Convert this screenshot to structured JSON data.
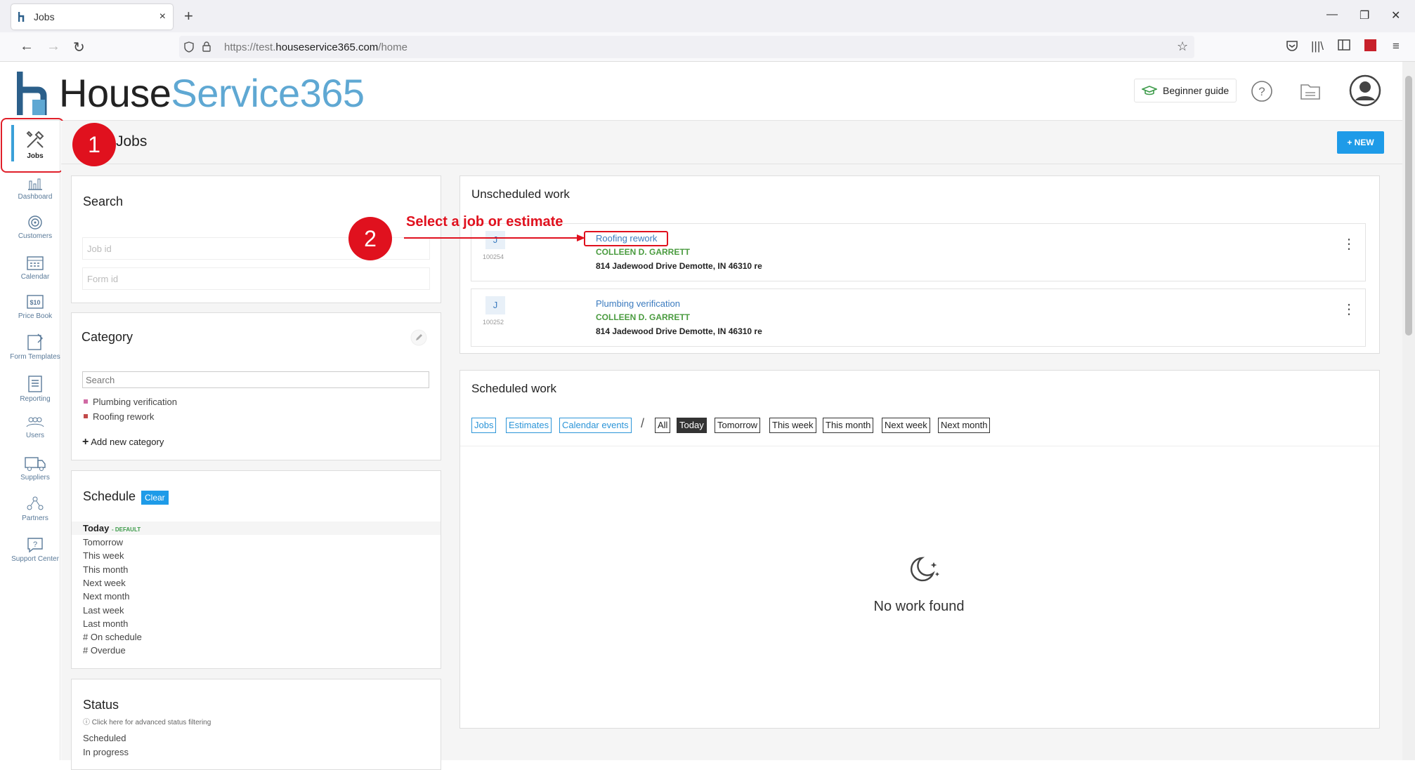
{
  "browser": {
    "tab_title": "Jobs",
    "tab_close": "×",
    "new_tab": "+",
    "url_prefix": "https://test.",
    "url_domain": "houseservice365.com",
    "url_path": "/home"
  },
  "app": {
    "logo_part1": "House",
    "logo_part2": "Service365",
    "beginner_guide": "Beginner guide"
  },
  "sidebar": {
    "items": [
      {
        "label": "Jobs"
      },
      {
        "label": "Dashboard"
      },
      {
        "label": "Customers"
      },
      {
        "label": "Calendar"
      },
      {
        "label": "Price Book"
      },
      {
        "label": "Form Templates"
      },
      {
        "label": "Reporting"
      },
      {
        "label": "Users"
      },
      {
        "label": "Suppliers"
      },
      {
        "label": "Partners"
      },
      {
        "label": "Support Center"
      }
    ]
  },
  "page": {
    "title": "Jobs",
    "new_button": "+ NEW"
  },
  "search_panel": {
    "title": "Search",
    "job_id_placeholder": "Job id",
    "form_id_placeholder": "Form id"
  },
  "category_panel": {
    "title": "Category",
    "search_placeholder": "Search",
    "categories": [
      {
        "name": "Plumbing verification",
        "color": "#d06aa4"
      },
      {
        "name": "Roofing rework",
        "color": "#c24a4a"
      }
    ],
    "add_new": "Add new category"
  },
  "schedule_panel": {
    "title": "Schedule",
    "clear_button": "Clear",
    "default_item": "Today",
    "default_tag": "- DEFAULT",
    "items": [
      "Tomorrow",
      "This week",
      "This month",
      "Next week",
      "Next month",
      "Last week",
      "Last month",
      "# On schedule",
      "# Overdue"
    ]
  },
  "status_panel": {
    "title": "Status",
    "hint": "ⓘ Click here for advanced status filtering",
    "items": [
      "Scheduled",
      "In progress"
    ]
  },
  "unscheduled": {
    "title": "Unscheduled work",
    "jobs": [
      {
        "badge": "J",
        "id": "100254",
        "title": "Roofing rework",
        "customer": "COLLEEN D. GARRETT",
        "address": "814 Jadewood Drive Demotte, IN 46310 re"
      },
      {
        "badge": "J",
        "id": "100252",
        "title": "Plumbing verification",
        "customer": "COLLEEN D. GARRETT",
        "address": "814 Jadewood Drive Demotte, IN 46310 re"
      }
    ]
  },
  "scheduled": {
    "title": "Scheduled work",
    "type_filters": [
      "Jobs",
      "Estimates",
      "Calendar events"
    ],
    "separator": "/",
    "time_filters": [
      "All",
      "Today",
      "Tomorrow",
      "This week",
      "This month",
      "Next week",
      "Next month"
    ],
    "active_time_filter": "Today",
    "empty_text": "No work found"
  },
  "annotations": {
    "step1": "1",
    "step2": "2",
    "step2_text": "Select a job or estimate"
  },
  "colors": {
    "accent_blue": "#1e9be8",
    "link_blue": "#3b7bbf",
    "customer_green": "#4a9b3f",
    "annotation_red": "#e0111e"
  }
}
